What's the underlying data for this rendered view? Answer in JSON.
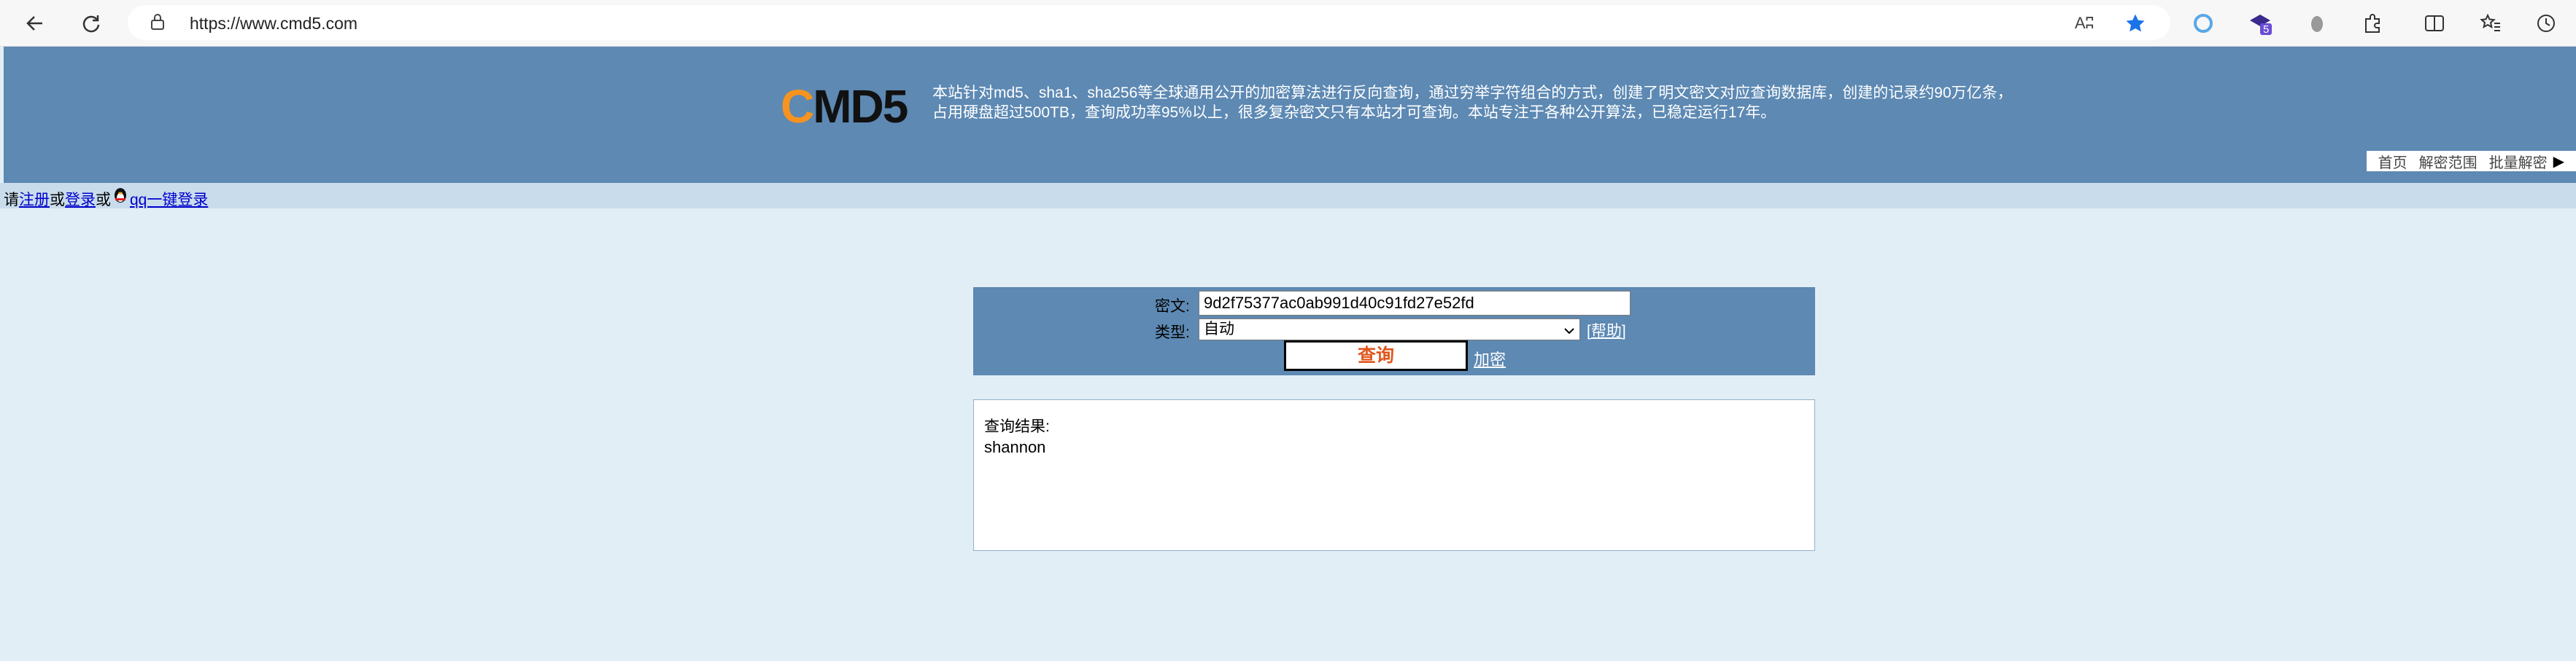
{
  "browser": {
    "url": "https://www.cmd5.com",
    "icons": {
      "back": "back-arrow-icon",
      "refresh": "refresh-icon",
      "lock": "lock-icon",
      "read_aloud": "read-aloud-icon",
      "favorite": "star-icon",
      "extension_badge": "5"
    },
    "read_aloud_text": "Aʭ"
  },
  "site": {
    "logo_c": "C",
    "logo_rest": "MD5",
    "intro_line1": "本站针对md5、sha1、sha256等全球通用公开的加密算法进行反向查询，通过穷举字符组合的方式，创建了明文密文对应查询数据库，创建的记录约90万亿条，",
    "intro_line2": "占用硬盘超过500TB，查询成功率95%以上，很多复杂密文只有本站才可查询。本站专注于各种公开算法，已稳定运行17年。",
    "nav": [
      "首页",
      "解密范围",
      "批量解密"
    ],
    "nav_arrow": "▶"
  },
  "login": {
    "prefix": "请",
    "register": "注册",
    "or1": "或",
    "login": "登录",
    "or2": "或",
    "qq_login": "qq一键登录"
  },
  "query": {
    "ciphertext_label": "密文:",
    "ciphertext_value": "9d2f75377ac0ab991d40c91fd27e52fd",
    "type_label": "类型:",
    "type_value": "自动",
    "help_open": "[",
    "help_text": "帮助",
    "help_close": "]",
    "query_button": "查询",
    "encrypt_link": "加密"
  },
  "result": {
    "label": "查询结果:",
    "value": "shannon"
  },
  "colors": {
    "header_bg": "#5d89b3",
    "page_bg": "#e2eef6",
    "logo_orange": "#f7931e",
    "query_text": "#e0561c"
  }
}
